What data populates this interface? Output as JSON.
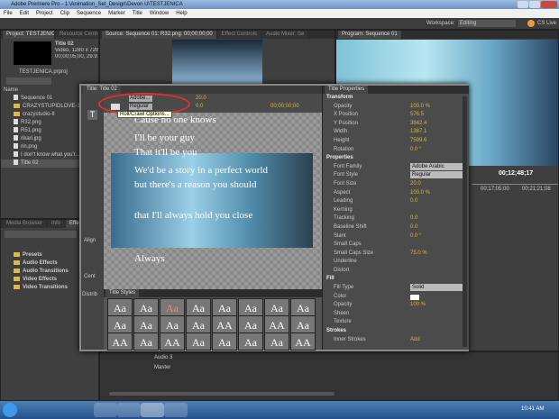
{
  "window": {
    "title": "Adobe Premiere Pro - 1:\\Animation_Set_Design\\Devon U\\TESTJENICA"
  },
  "menu": [
    "File",
    "Edit",
    "Project",
    "Clip",
    "Sequence",
    "Marker",
    "Title",
    "Window",
    "Help"
  ],
  "workspace": {
    "label": "Workspace:",
    "value": "Editing",
    "cs_live": "CS Live"
  },
  "project": {
    "tab": "Project: TESTJENICA",
    "tab2": "Resource Central",
    "clip_name": "Title 02",
    "clip_info": "Video, 1280 x 720 (1.0...",
    "clip_info2": "00;00;05;00, 29.97 fps",
    "project_file": "TESTJENICA.prproj",
    "col_name": "Name",
    "items": [
      {
        "name": "Sequence 01",
        "type": "seq"
      },
      {
        "name": "CRAZYSTUPIDLOVE-1",
        "type": "folder"
      },
      {
        "name": "crazystudio-II",
        "type": "folder"
      },
      {
        "name": "R32.png",
        "type": "file"
      },
      {
        "name": "R51.png",
        "type": "file"
      },
      {
        "name": "rikari.jpg",
        "type": "file"
      },
      {
        "name": "rin.png",
        "type": "file"
      },
      {
        "name": "I don't know what you'r...",
        "type": "file"
      },
      {
        "name": "Title 02",
        "type": "title"
      }
    ]
  },
  "effects": {
    "tab": "Media Browser",
    "tab2": "Info",
    "tab3": "Effects",
    "items": [
      "Presets",
      "Audio Effects",
      "Audio Transitions",
      "Video Effects",
      "Video Transitions"
    ]
  },
  "source": {
    "tab": "Source: Sequence 01: R32.png: 00;00;00;00",
    "tab2": "Effect Controls",
    "tab3": "Audio Mixer: Se"
  },
  "program": {
    "tab": "Program: Sequence 01",
    "timecode": "00;12;48;17",
    "ruler": [
      "00;17;05;00",
      "00;21;21;08"
    ]
  },
  "title_window": {
    "tab": "Title: Title 02",
    "font": "Adobe...",
    "style": "Regular",
    "tooltip": "Roll/Crawl Options...",
    "font_size": "20.0",
    "kerning": "0.0",
    "timecode": "00;00;00;00",
    "lines": [
      "Cause no one knows",
      "I'll be your guy",
      "That it'll be you",
      "We'd be a story in a perfect world",
      "but there's a reason you should",
      "that I'll always hold you close",
      "Always"
    ],
    "side_labels": [
      "Align",
      "Cent",
      "Distrib"
    ],
    "styles_tab": "Title Styles"
  },
  "properties": {
    "tab": "Title Properties",
    "sections": [
      {
        "title": "Transform",
        "rows": [
          [
            "Opacity",
            "100.0 %"
          ],
          [
            "X Position",
            "576.5"
          ],
          [
            "Y Position",
            "3842.4"
          ],
          [
            "Width",
            "1387.1"
          ],
          [
            "Height",
            "7599.6"
          ],
          [
            "Rotation",
            "0.0 °"
          ]
        ]
      },
      {
        "title": "Properties",
        "rows": [
          [
            "Font Family",
            "Adobe Arabic"
          ],
          [
            "Font Style",
            "Regular"
          ],
          [
            "Font Size",
            "20.0"
          ],
          [
            "Aspect",
            "100.0 %"
          ],
          [
            "Leading",
            "0.0"
          ],
          [
            "Kerning",
            ""
          ],
          [
            "Tracking",
            "0.0"
          ],
          [
            "Baseline Shift",
            "0.0"
          ],
          [
            "Slant",
            "0.0 °"
          ],
          [
            "Small Caps",
            ""
          ],
          [
            "Small Caps Size",
            "75.0 %"
          ],
          [
            "Underline",
            ""
          ],
          [
            "Distort",
            ""
          ]
        ]
      },
      {
        "title": "Fill",
        "rows": [
          [
            "Fill Type",
            "Solid"
          ],
          [
            "Color",
            ""
          ],
          [
            "Opacity",
            "100 %"
          ],
          [
            "Sheen",
            ""
          ],
          [
            "Texture",
            ""
          ]
        ]
      },
      {
        "title": "Strokes",
        "rows": [
          [
            "Inner Strokes",
            "Add"
          ]
        ]
      }
    ]
  },
  "timeline": {
    "tracks": [
      "Audio 3",
      "Master"
    ]
  },
  "styles": [
    "Aa",
    "Aa",
    "Aa",
    "Aa",
    "Aa",
    "Aa",
    "Aa",
    "Aa",
    "Aa",
    "Aa",
    "Aa",
    "Aa",
    "AA",
    "Aa",
    "AA",
    "Aa",
    "AA",
    "Aa",
    "AA",
    "Aa",
    "Aa",
    "Aa",
    "Aa",
    "AA"
  ],
  "taskbar": {
    "time": "10:41 AM"
  },
  "colors": {
    "accent": "#d9b53b",
    "highlight": "#e03030"
  }
}
